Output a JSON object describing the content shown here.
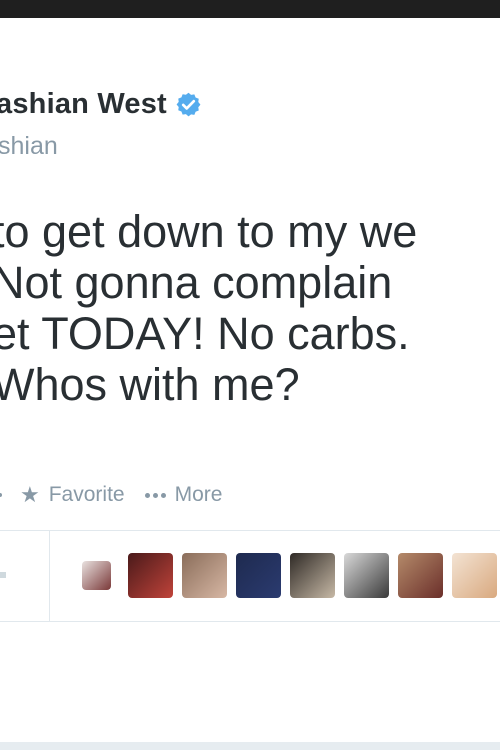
{
  "tweet": {
    "display_name": "ashian West",
    "handle": "shian",
    "verified": true,
    "text_lines": [
      "to get down to my we",
      " Not gonna complain ",
      "et TODAY! No carbs. ",
      "Whos with me?"
    ],
    "actions": [
      {
        "icon": "star-icon",
        "label": "Favorite"
      },
      {
        "icon": "more-icon",
        "label": "More"
      }
    ],
    "favoriter_avatars": [
      {
        "name": "avatar-1",
        "colors": [
          "#e9e2e0",
          "#7a3838"
        ]
      },
      {
        "name": "avatar-2",
        "colors": [
          "#4a1a1a",
          "#c0433a"
        ]
      },
      {
        "name": "avatar-3",
        "colors": [
          "#8a6d5a",
          "#d7b7a4"
        ]
      },
      {
        "name": "avatar-4",
        "colors": [
          "#1e2a4f",
          "#2b3b70"
        ]
      },
      {
        "name": "avatar-5",
        "colors": [
          "#2f2a26",
          "#c7b9a6"
        ]
      },
      {
        "name": "avatar-6",
        "colors": [
          "#d9d9d9",
          "#3a3a3a"
        ]
      },
      {
        "name": "avatar-7",
        "colors": [
          "#b48a6a",
          "#6b2f2a"
        ]
      },
      {
        "name": "avatar-8",
        "colors": [
          "#f3e3d3",
          "#d9a97f"
        ]
      }
    ]
  },
  "colors": {
    "text": "#292f33",
    "muted": "#8899a6",
    "verified": "#55acee",
    "border": "#e1e8ed",
    "background": "#e6ecf0"
  }
}
